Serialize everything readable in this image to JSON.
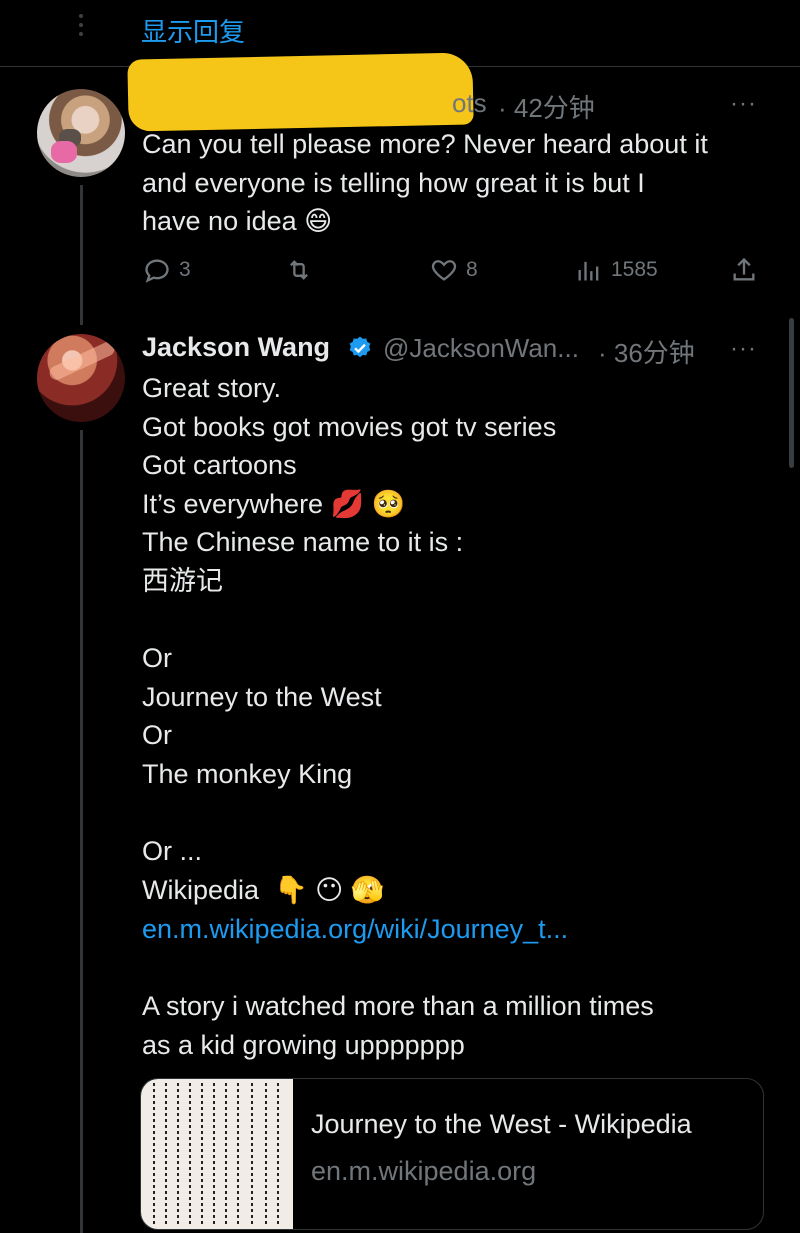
{
  "top": {
    "show_replies": "显示回复"
  },
  "tweet1": {
    "handle_suffix": "ots",
    "time": "· 42分钟",
    "more": "···",
    "body": "Can you tell please more? Never heard about it\nand everyone is telling how great it is but I\nhave no idea 😄",
    "actions": {
      "replies": "3",
      "likes": "8",
      "views": "1585"
    }
  },
  "tweet2": {
    "name": "Jackson Wang",
    "handle": "@JacksonWan...",
    "time": "· 36分钟",
    "more": "···",
    "body": "Great story.\nGot books got movies got tv series\nGot cartoons\nIt’s everywhere 💋 🥺\nThe Chinese name to it is :\n西游记\n\nOr\nJourney to the West\nOr\nThe monkey King\n\nOr ...\nWikipedia  👇 😶 🫣",
    "link": "en.m.wikipedia.org/wiki/Journey_t...",
    "body2": "A story i watched more than a million times\nas a kid growing uppppppp",
    "card": {
      "title": "Journey to the West - Wikipedia",
      "domain": "en.m.wikipedia.org"
    }
  },
  "colors": {
    "background": "#000000",
    "text": "#e7e9ea",
    "muted": "#71767b",
    "accent": "#1d9bf0",
    "redaction": "#f5c518"
  }
}
